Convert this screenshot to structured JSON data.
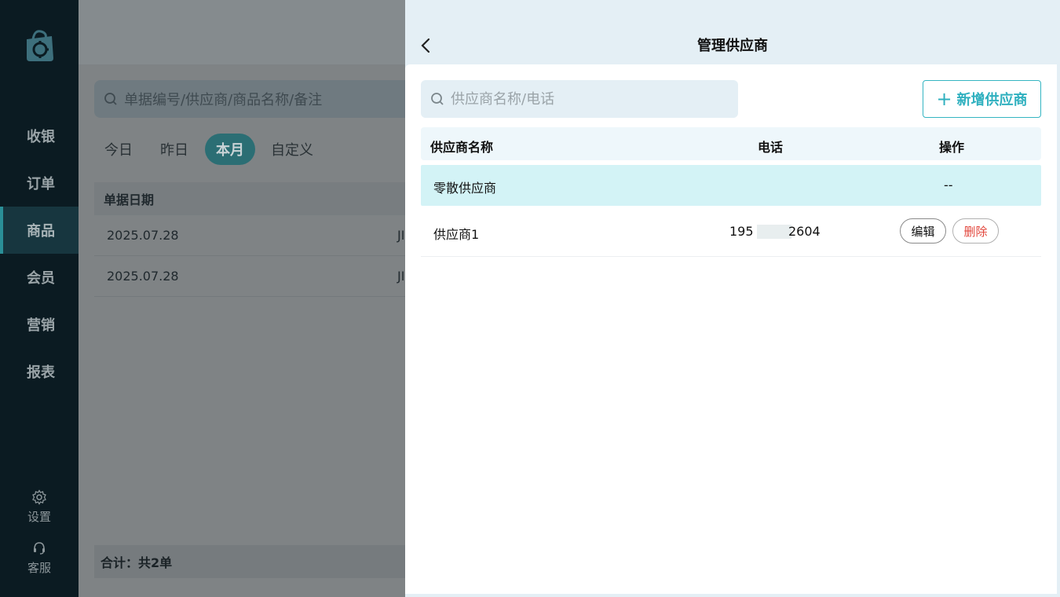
{
  "sidebar": {
    "items": [
      {
        "label": "收银"
      },
      {
        "label": "订单"
      },
      {
        "label": "商品"
      },
      {
        "label": "会员"
      },
      {
        "label": "营销"
      },
      {
        "label": "报表"
      }
    ],
    "active_index": 2,
    "settings_label": "设置",
    "service_label": "客服"
  },
  "main": {
    "search_placeholder": "单据编号/供应商/商品名称/备注",
    "date_tabs": [
      "今日",
      "昨日",
      "本月",
      "自定义"
    ],
    "active_date_tab": "本月",
    "column_header": "单据日期",
    "rows": [
      {
        "date": "2025.07.28",
        "code_prefix": "JI"
      },
      {
        "date": "2025.07.28",
        "code_prefix": "JI"
      }
    ],
    "footer_total": "合计：共2单"
  },
  "drawer": {
    "title": "管理供应商",
    "search_placeholder": "供应商名称/电话",
    "add_button_label": "新增供应商",
    "columns": {
      "name": "供应商名称",
      "phone": "电话",
      "actions": "操作"
    },
    "rows": [
      {
        "name": "零散供应商",
        "phone": "",
        "actions": "--"
      },
      {
        "name": "供应商1",
        "phone_prefix": "195",
        "phone_suffix": "2604",
        "edit_label": "编辑",
        "delete_label": "删除"
      }
    ]
  },
  "colors": {
    "accent": "#2fb0bf",
    "danger": "#e2453b",
    "sidebar_bg": "#0b1b22",
    "highlight_row": "#d3f3f6"
  }
}
